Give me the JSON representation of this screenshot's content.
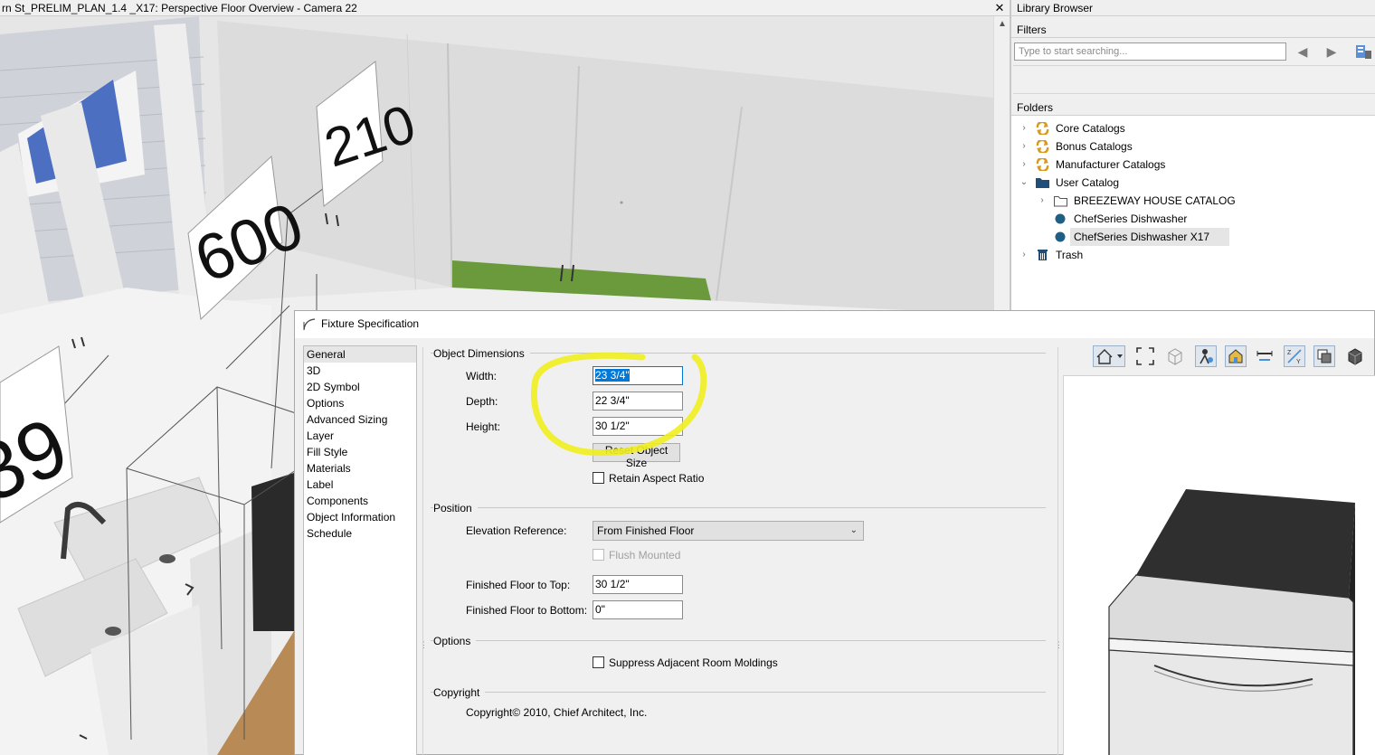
{
  "viewport": {
    "title": "rn St_PRELIM_PLAN_1.4 _X17: Perspective Floor Overview - Camera 22",
    "close_glyph": "✕",
    "dimension_labels": [
      "210",
      "600",
      "39"
    ]
  },
  "library": {
    "title": "Library Browser",
    "filters_label": "Filters",
    "search_placeholder": "Type to start searching...",
    "folders_label": "Folders",
    "tree": [
      {
        "label": "Core Catalogs",
        "icon": "catalog-sync-icon",
        "expanded": false,
        "level": 0
      },
      {
        "label": "Bonus Catalogs",
        "icon": "catalog-sync-icon",
        "expanded": false,
        "level": 0
      },
      {
        "label": "Manufacturer Catalogs",
        "icon": "catalog-sync-icon",
        "expanded": false,
        "level": 0
      },
      {
        "label": "User Catalog",
        "icon": "folder-filled-icon",
        "expanded": true,
        "level": 0
      },
      {
        "label": "BREEZEWAY HOUSE CATALOG",
        "icon": "folder-outline-icon",
        "expanded": false,
        "level": 1
      },
      {
        "label": "ChefSeries Dishwasher",
        "icon": "object-dot-icon",
        "level": 1
      },
      {
        "label": "ChefSeries Dishwasher X17",
        "icon": "object-dot-icon",
        "level": 1,
        "selected": true
      },
      {
        "label": "Trash",
        "icon": "trash-icon",
        "expanded": false,
        "level": 0
      }
    ]
  },
  "dialog": {
    "title": "Fixture Specification",
    "nav": [
      "General",
      "3D",
      "2D Symbol",
      "Options",
      "Advanced Sizing",
      "Layer",
      "Fill Style",
      "Materials",
      "Label",
      "Components",
      "Object Information",
      "Schedule"
    ],
    "active_nav": "General",
    "object_dimensions": {
      "group_label": "Object Dimensions",
      "width_label": "Width:",
      "width_value": "23 3/4\"",
      "depth_label": "Depth:",
      "depth_value": "22 3/4\"",
      "height_label": "Height:",
      "height_value": "30 1/2\"",
      "reset_button": "Reset Object Size",
      "retain_aspect_label": "Retain Aspect Ratio"
    },
    "position": {
      "group_label": "Position",
      "elevation_label": "Elevation Reference:",
      "elevation_value": "From Finished Floor",
      "flush_label": "Flush Mounted",
      "top_label": "Finished Floor to Top:",
      "top_value": "30 1/2\"",
      "bottom_label": "Finished Floor to Bottom:",
      "bottom_value": "0\""
    },
    "options": {
      "group_label": "Options",
      "suppress_label": "Suppress Adjacent Room Moldings"
    },
    "copyright": {
      "group_label": "Copyright",
      "text": "Copyright© 2010, Chief Architect, Inc."
    }
  },
  "colors": {
    "highlight": "#f0ee1e",
    "selection": "#0078d7",
    "folder_blue": "#1f4e79",
    "catalog_orange": "#d89a1c"
  }
}
